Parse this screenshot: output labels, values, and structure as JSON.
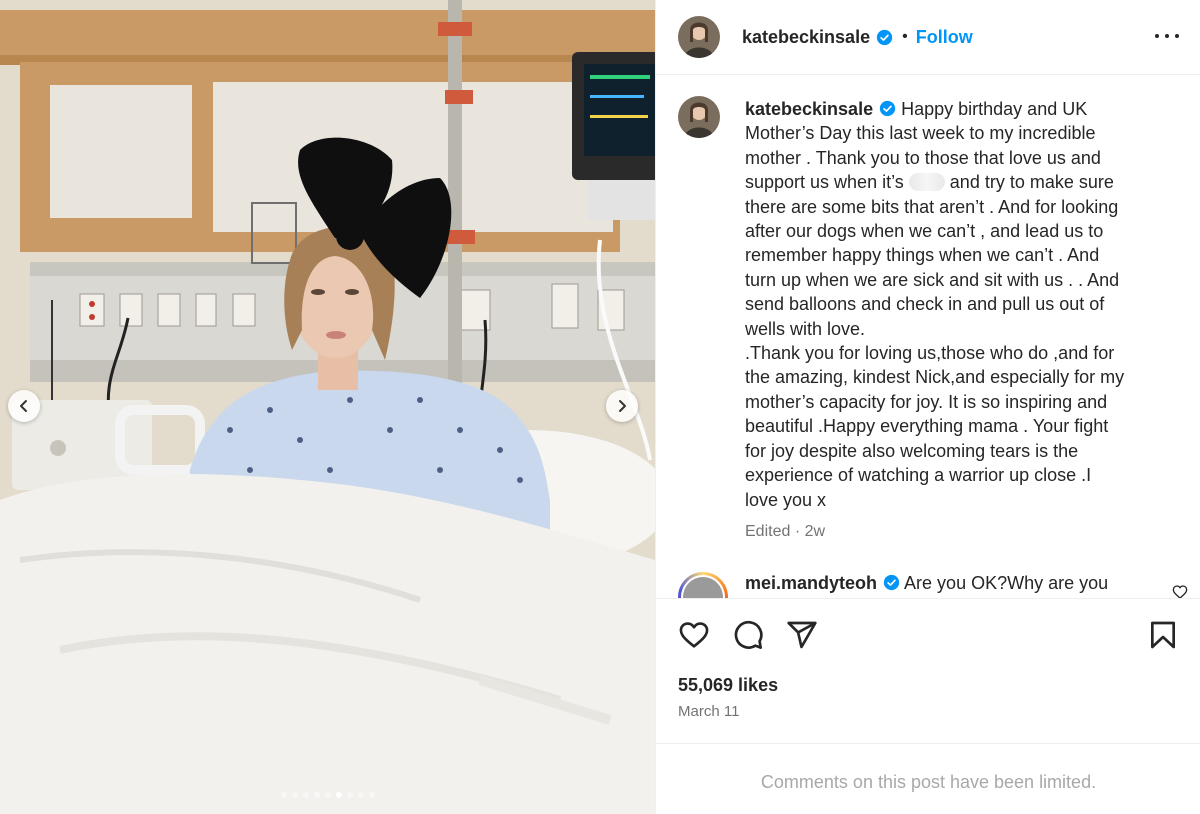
{
  "header": {
    "username": "katebeckinsale",
    "separator": "•",
    "follow_label": "Follow"
  },
  "caption": {
    "username": "katebeckinsale",
    "segments": [
      "Happy birthday and UK",
      "Mother’s Day this last week to my incredible",
      "mother . Thank you to those that love us and",
      "support us when it’s",
      "and try to make sure",
      "there are some bits that aren’t . And for looking",
      "after our dogs when we can’t , and lead us to",
      "remember happy things when we can’t . And",
      "turn up when we are sick and sit with us . . And",
      "send balloons and check in and pull us out of",
      "wells with love.",
      ".Thank you for loving us,those who do ,and for",
      "the amazing, kindest Nick,and especially for my",
      "mother’s capacity for joy. It is so inspiring and",
      "beautiful .Happy everything mama . Your fight",
      "for joy despite also welcoming tears is the",
      "experience of watching a warrior up close .I",
      "love you x"
    ],
    "meta": "Edited · 2w"
  },
  "comment": {
    "username": "mei.mandyteoh",
    "text": "Are you OK?Why are you"
  },
  "stats": {
    "likes": "55,069 likes",
    "date": "March 11"
  },
  "footer": {
    "limited": "Comments on this post have been limited."
  },
  "colors": {
    "link": "#0095f6",
    "verified": "#0095f6",
    "secondary_text": "#737373"
  },
  "icons": [
    "chevron-left-icon",
    "chevron-right-icon",
    "more-icon",
    "verified-icon",
    "heart-icon",
    "comment-icon",
    "share-icon",
    "bookmark-icon"
  ],
  "carousel": {
    "total_slides": 9,
    "active_slide": 6
  }
}
